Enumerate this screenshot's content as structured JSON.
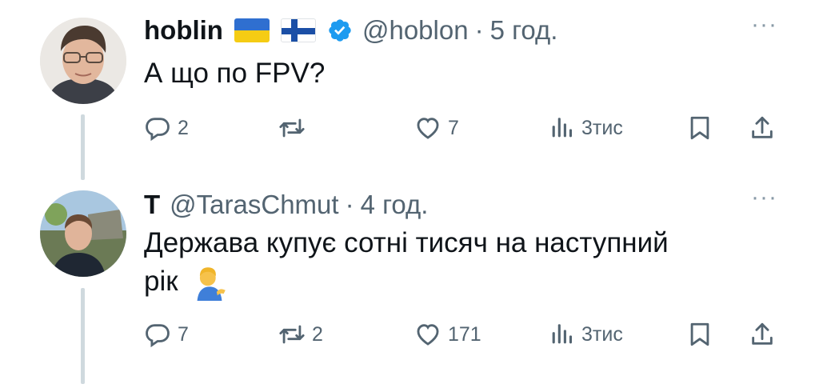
{
  "tweets": [
    {
      "name": "hoblin",
      "handle": "@hoblon",
      "separator": "·",
      "time": "5 год.",
      "text": "А що по FPV?",
      "more": "···",
      "flags": [
        "ukraine-flag",
        "finland-flag"
      ],
      "verified": true,
      "stats": {
        "replies": "2",
        "retweets": "",
        "likes": "7",
        "views": "3тис"
      }
    },
    {
      "name": "T",
      "handle": "@TarasChmut",
      "separator": "·",
      "time": "4 год.",
      "text_line1": "Держава купує сотні тисяч на наступний",
      "text_line2": "рік",
      "emoji": "person-tipping-hand-emoji",
      "more": "···",
      "stats": {
        "replies": "7",
        "retweets": "2",
        "likes": "171",
        "views": "3тис"
      }
    }
  ],
  "colors": {
    "text": "#0f1419",
    "muted": "#536471",
    "thread_line": "#cfd9de",
    "verified": "#1d9bf0"
  }
}
